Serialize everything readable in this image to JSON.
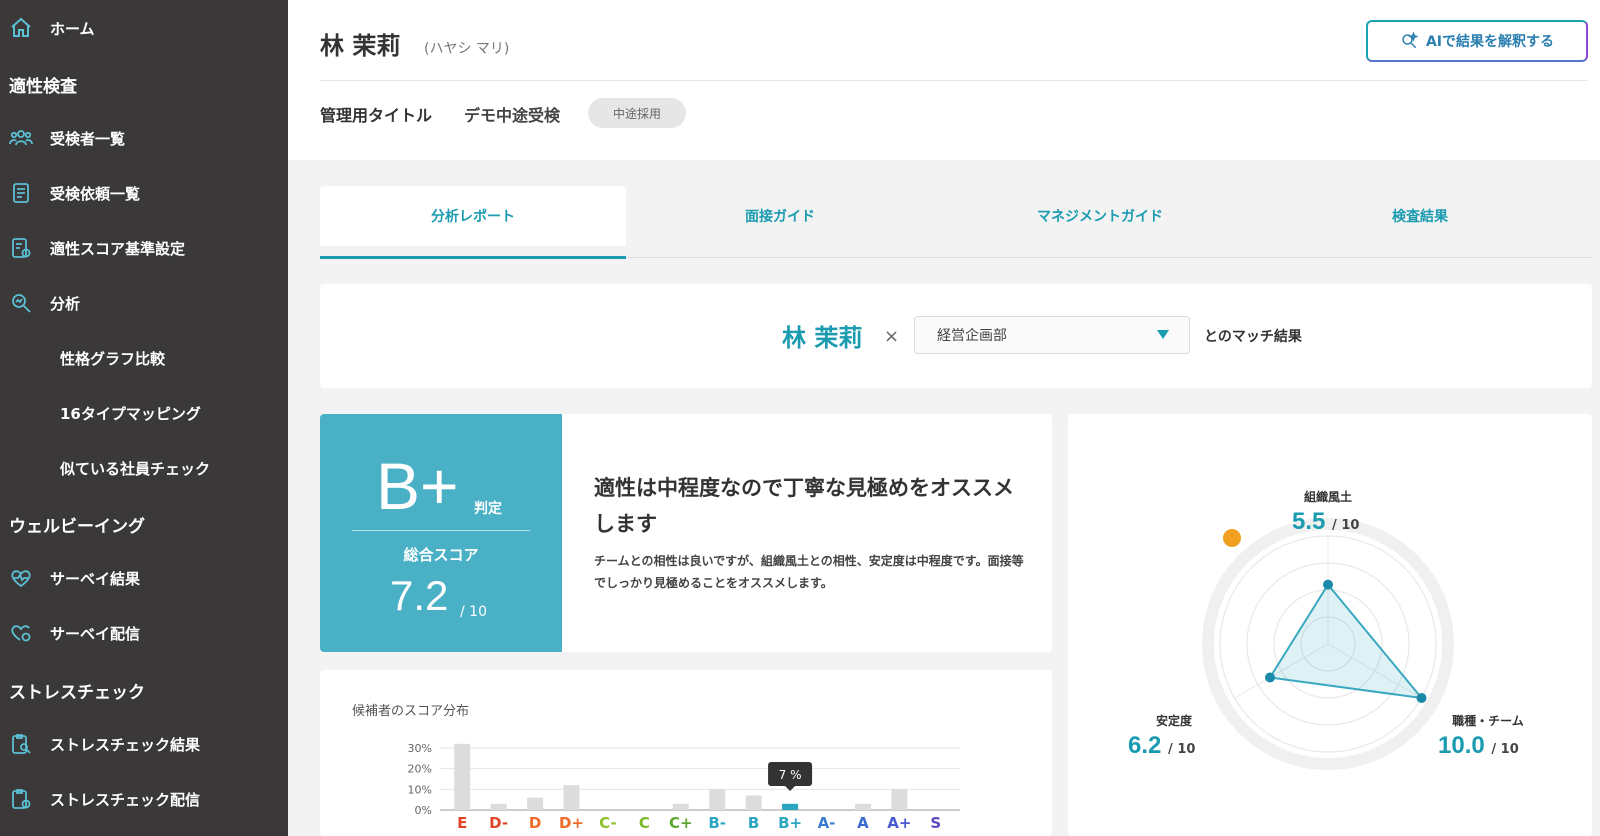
{
  "sidebar": {
    "home": "ホーム",
    "section_aptitude": "適性検査",
    "examinee_list": "受検者一覧",
    "request_list": "受検依頼一覧",
    "score_settings": "適性スコア基準設定",
    "analysis": "分析",
    "sub_personality": "性格グラフ比較",
    "sub_16type": "16タイプマッピング",
    "sub_similar": "似ている社員チェック",
    "section_wellbeing": "ウェルビーイング",
    "survey_results": "サーベイ結果",
    "survey_send": "サーベイ配信",
    "section_stress": "ストレスチェック",
    "stress_results": "ストレスチェック結果",
    "stress_send": "ストレスチェック配信"
  },
  "header": {
    "name": "林 茉莉",
    "kana": "(ハヤシ マリ)",
    "ai_button": "AIで結果を解釈する",
    "meta_label": "管理用タイトル",
    "meta_value": "デモ中途受検",
    "badge": "中途採用"
  },
  "tabs": [
    "分析レポート",
    "面接ガイド",
    "マネジメントガイド",
    "検査結果"
  ],
  "match": {
    "name": "林 茉莉",
    "times": "×",
    "department": "経営企画部",
    "suffix": "とのマッチ結果"
  },
  "score": {
    "grade": "B+",
    "grade_tag": "判定",
    "total_label": "総合スコア",
    "total_value": "7.2",
    "total_max": "/ 10",
    "verdict": "適性は中程度なので丁寧な見極めをオススメします",
    "description": "チームとの相性は良いですが、組織風土との相性、安定度は中程度です。面接等でしっかり見極めることをオススメします。"
  },
  "chart_data": {
    "type": "bar",
    "title": "候補者のスコア分布",
    "categories": [
      "E",
      "D-",
      "D",
      "D+",
      "C-",
      "C",
      "C+",
      "B-",
      "B",
      "B+",
      "A-",
      "A",
      "A+",
      "S"
    ],
    "values": [
      32,
      3,
      6,
      12,
      0,
      0,
      3,
      10,
      7,
      3,
      0,
      3,
      10
    ],
    "ylim": [
      0,
      30
    ],
    "yticks": [
      "30%",
      "20%",
      "10%",
      "0%"
    ],
    "highlight": "B+",
    "tooltip": "7 %",
    "category_colors": {
      "E": "#e0442b",
      "D-": "#e0442b",
      "D": "#f06a2a",
      "D+": "#f06a2a",
      "C-": "#8cbf2a",
      "C": "#7cb82a",
      "C+": "#5aa830",
      "B-": "#2aa6c0",
      "B": "#2aa6c0",
      "B+": "#2aa6c0",
      "A-": "#3a7ad0",
      "A": "#3a6ad0",
      "A+": "#4a5ad0",
      "S": "#5a4ac0"
    }
  },
  "radar": {
    "axes": [
      {
        "label": "組織風土",
        "value": "5.5",
        "max": "/ 10",
        "score": 5.5
      },
      {
        "label": "職種・チーム",
        "value": "10.0",
        "max": "/ 10",
        "score": 10.0
      },
      {
        "label": "安定度",
        "value": "6.2",
        "max": "/ 10",
        "score": 6.2
      }
    ]
  }
}
